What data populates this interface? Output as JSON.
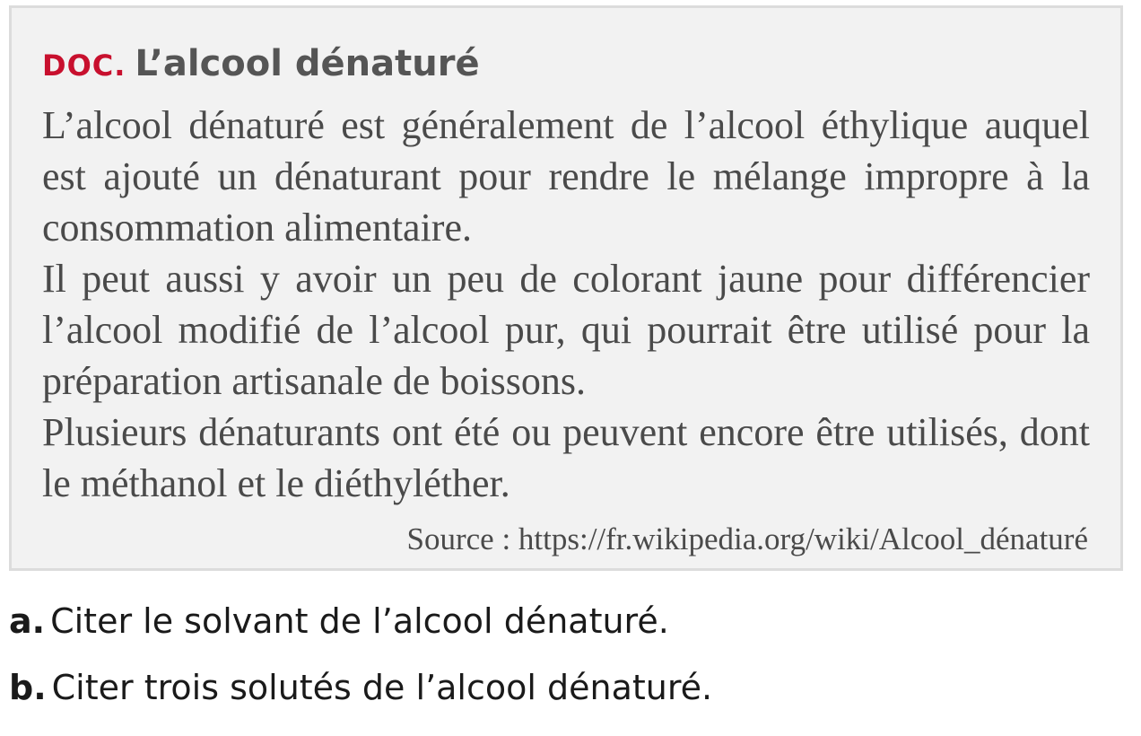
{
  "doc": {
    "tag": "DOC.",
    "title": "L’alcool dénaturé",
    "paragraphs": [
      "L’alcool  dénaturé est généralement de l’alcool éthylique auquel est ajouté un dénaturant pour rendre le mélange impropre à la consommation alimentaire.",
      "Il peut aussi y avoir un peu de colorant jaune pour différencier l’alcool modifié de l’alcool pur, qui pourrait être utilisé pour la préparation artisanale de boissons.",
      "Plusieurs dénaturants ont été ou peuvent encore être utilisés, dont le méthanol et le diéthyléther."
    ],
    "source": "Source : https://fr.wikipedia.org/wiki/Alcool_dénaturé"
  },
  "questions": [
    {
      "letter": "a.",
      "text": "Citer le solvant de l’alcool dénaturé."
    },
    {
      "letter": "b.",
      "text": "Citer trois solutés de l’alcool dénaturé."
    }
  ],
  "colors": {
    "tag": "#c8102e",
    "box_background": "#f2f2f2",
    "box_border": "#dcdcdc",
    "body_text": "#4a4a4a"
  }
}
